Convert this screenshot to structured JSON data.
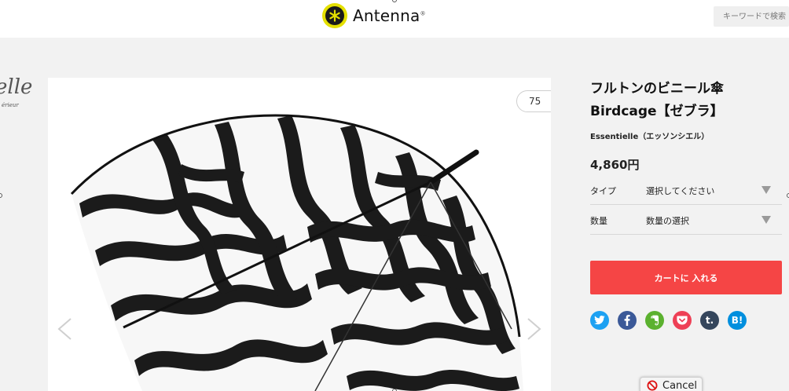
{
  "header": {
    "logo_text": "Antenna",
    "logo_tm": "®",
    "search_placeholder": "キーワードで検索"
  },
  "brand_peek": {
    "large": "elle",
    "small": "érieur"
  },
  "gallery": {
    "counter": "75",
    "prev_icon": "chevron-left-icon",
    "next_icon": "chevron-right-icon"
  },
  "product": {
    "title_line1": "フルトンのビニール傘",
    "title_line2": "Birdcage【ゼブラ】",
    "brand": "Essentielle（エッソンシエル）",
    "price": "4,860円",
    "options": [
      {
        "label": "タイプ",
        "value": "選択してください"
      },
      {
        "label": "数量",
        "value": "数量の選択"
      }
    ],
    "cart_label": "カートに 入れる"
  },
  "share": [
    {
      "icon": "twitter-icon",
      "glyph": "t",
      "color": "#1da1f2"
    },
    {
      "icon": "facebook-icon",
      "glyph": "f",
      "color": "#3b5998"
    },
    {
      "icon": "evernote-icon",
      "glyph": "e",
      "color": "#5bb12f"
    },
    {
      "icon": "pocket-icon",
      "glyph": "p",
      "color": "#ee4056"
    },
    {
      "icon": "tumblr-icon",
      "glyph": "t.",
      "color": "#35465c"
    },
    {
      "icon": "hatena-bookmark-icon",
      "glyph": "B!",
      "color": "#008fde"
    }
  ],
  "overlay": {
    "cancel_label": "Cancel"
  },
  "colors": {
    "accent": "#f54545",
    "logo_yellow": "#e4e000"
  }
}
